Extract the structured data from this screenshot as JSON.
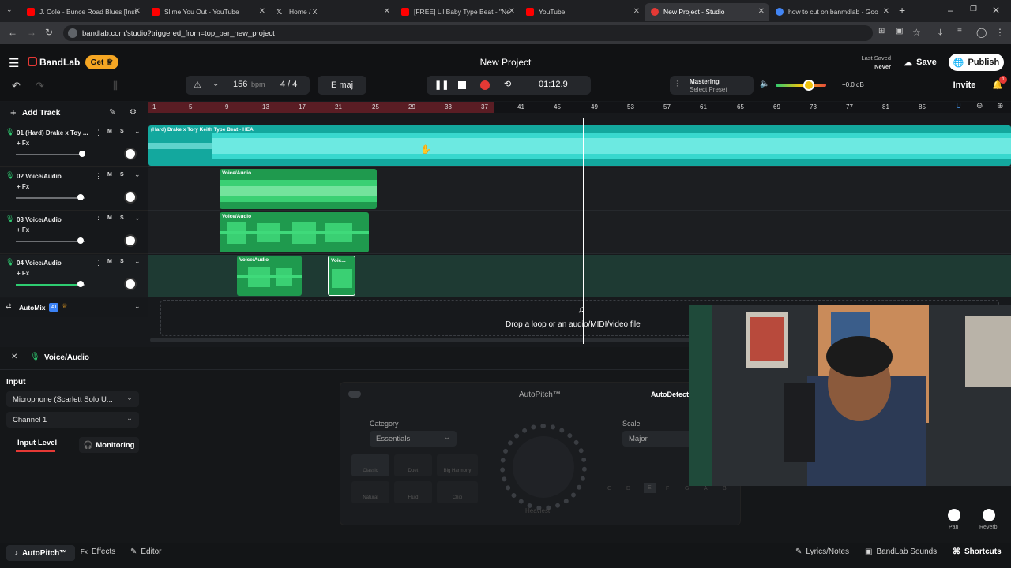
{
  "browser": {
    "tabs": [
      {
        "title": "J. Cole - Bunce Road Blues [Inst",
        "color": "#ff0000"
      },
      {
        "title": "Slime You Out - YouTube",
        "color": "#ff0000"
      },
      {
        "title": "Home / X",
        "color": "#ffffff"
      },
      {
        "title": "[FREE] Lil Baby Type Beat - \"Ne",
        "color": "#ff0000"
      },
      {
        "title": "YouTube",
        "color": "#ff0000"
      },
      {
        "title": "New Project - Studio",
        "color": "#e53935"
      },
      {
        "title": "how to cut on banmdlab - Goo",
        "color": "#4285f4"
      }
    ],
    "url": "bandlab.com/studio?triggered_from=top_bar_new_project"
  },
  "header": {
    "brand": "BandLab",
    "get_label": "Get",
    "project_title": "New Project",
    "last_saved_label": "Last Saved",
    "last_saved_value": "Never",
    "save_label": "Save",
    "publish_label": "Publish",
    "invite_label": "Invite",
    "notification_count": "1"
  },
  "transport": {
    "bpm_value": "156",
    "bpm_unit": "bpm",
    "time_signature": "4 / 4",
    "key": "E maj",
    "time": "01:12.9",
    "mastering_label": "Mastering",
    "select_preset": "Select Preset",
    "master_level": "+0.0 dB"
  },
  "toolbar": {
    "add_track": "Add Track"
  },
  "ruler": [
    "1",
    "5",
    "9",
    "13",
    "17",
    "21",
    "25",
    "29",
    "33",
    "37",
    "41",
    "45",
    "49",
    "53",
    "57",
    "61",
    "65",
    "69",
    "73",
    "77",
    "81",
    "85"
  ],
  "tracks": [
    {
      "name": "01 (Hard) Drake x Toy ...",
      "fx": "+ Fx",
      "clips": [
        {
          "label": "(Hard) Drake x Tory Keith Type Beat - HEA"
        }
      ]
    },
    {
      "name": "02 Voice/Audio",
      "fx": "+ Fx",
      "clips": [
        {
          "label": "Voice/Audio"
        }
      ]
    },
    {
      "name": "03 Voice/Audio",
      "fx": "+ Fx",
      "clips": [
        {
          "label": "Voice/Audio"
        }
      ]
    },
    {
      "name": "04 Voice/Audio",
      "fx": "+ Fx",
      "clips": [
        {
          "label": "Voice/Audio"
        },
        {
          "label": "Voic..."
        }
      ]
    }
  ],
  "automix": {
    "label": "AutoMix",
    "badge": "AI"
  },
  "dropzone": "Drop a loop or an audio/MIDI/video file",
  "panel": {
    "track_title": "Voice/Audio",
    "input_label": "Input",
    "input_device": "Microphone (Scarlett Solo U...",
    "channel": "Channel 1",
    "input_level": "Input Level",
    "monitoring": "Monitoring",
    "autopitch_title": "AutoPitch™",
    "autodetect": "AutoDetect",
    "category_label": "Category",
    "category_value": "Essentials",
    "scale_label": "Scale",
    "scale_value": "Major",
    "presets": [
      "Classic",
      "Duet",
      "Big Harmony",
      "Natural",
      "Fluid",
      "Chip"
    ],
    "heaviest": "Heaviest",
    "notes": [
      "C",
      "D",
      "E",
      "F",
      "G",
      "A",
      "B"
    ],
    "pan_label": "Pan",
    "reverb_label": "Reverb"
  },
  "footer": {
    "autopitch": "AutoPitch™",
    "effects": "Effects",
    "editor": "Editor",
    "lyrics": "Lyrics/Notes",
    "sounds": "BandLab Sounds",
    "shortcuts": "Shortcuts"
  }
}
